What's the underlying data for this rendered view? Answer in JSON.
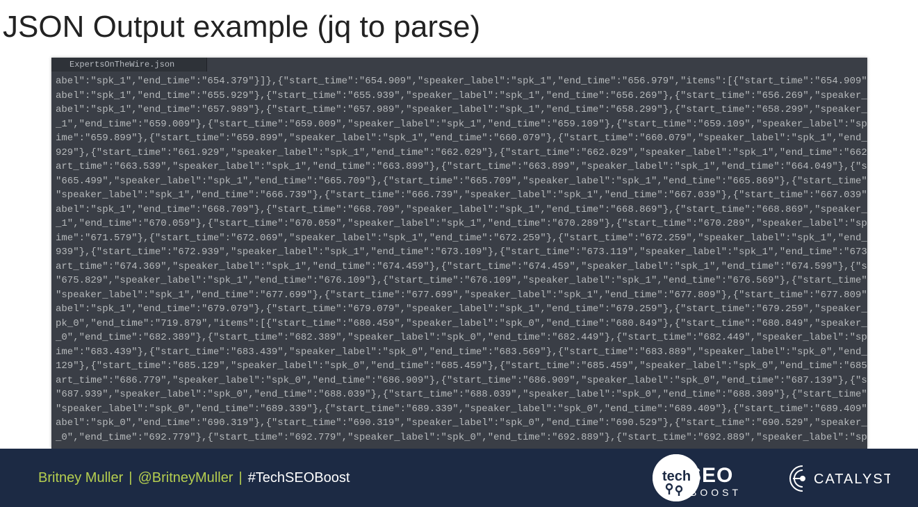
{
  "title": "JSON Output example (jq to parse)",
  "code": {
    "filename": "ExpertsOnTheWire.json",
    "lines": [
      "abel\":\"spk_1\",\"end_time\":\"654.379\"}]},{\"start_time\":\"654.909\",\"speaker_label\":\"spk_1\",\"end_time\":\"656.979\",\"items\":[{\"start_time\":\"654.909\",\"",
      "abel\":\"spk_1\",\"end_time\":\"655.929\"},{\"start_time\":\"655.939\",\"speaker_label\":\"spk_1\",\"end_time\":\"656.269\"},{\"start_time\":\"656.269\",\"speaker_l",
      "abel\":\"spk_1\",\"end_time\":\"657.989\"},{\"start_time\":\"657.989\",\"speaker_label\":\"spk_1\",\"end_time\":\"658.299\"},{\"start_time\":\"658.299\",\"speaker_l",
      "_1\",\"end_time\":\"659.009\"},{\"start_time\":\"659.009\",\"speaker_label\":\"spk_1\",\"end_time\":\"659.109\"},{\"start_time\":\"659.109\",\"speaker_label\":\"spk",
      "ime\":\"659.899\"},{\"start_time\":\"659.899\",\"speaker_label\":\"spk_1\",\"end_time\":\"660.079\"},{\"start_time\":\"660.079\",\"speaker_label\":\"spk_1\",\"end_t",
      "929\"},{\"start_time\":\"661.929\",\"speaker_label\":\"spk_1\",\"end_time\":\"662.029\"},{\"start_time\":\"662.029\",\"speaker_label\":\"spk_1\",\"end_time\":\"662.",
      "art_time\":\"663.539\",\"speaker_label\":\"spk_1\",\"end_time\":\"663.899\"},{\"start_time\":\"663.899\",\"speaker_label\":\"spk_1\",\"end_time\":\"664.049\"},{\"st",
      "\"665.499\",\"speaker_label\":\"spk_1\",\"end_time\":\"665.709\"},{\"start_time\":\"665.709\",\"speaker_label\":\"spk_1\",\"end_time\":\"665.869\"},{\"start_time\":",
      "\"speaker_label\":\"spk_1\",\"end_time\":\"666.739\"},{\"start_time\":\"666.739\",\"speaker_label\":\"spk_1\",\"end_time\":\"667.039\"},{\"start_time\":\"667.039\",",
      "abel\":\"spk_1\",\"end_time\":\"668.709\"},{\"start_time\":\"668.709\",\"speaker_label\":\"spk_1\",\"end_time\":\"668.869\"},{\"start_time\":\"668.869\",\"speaker_l",
      "_1\",\"end_time\":\"670.059\"},{\"start_time\":\"670.059\",\"speaker_label\":\"spk_1\",\"end_time\":\"670.289\"},{\"start_time\":\"670.289\",\"speaker_label\":\"spk",
      "ime\":\"671.579\"},{\"start_time\":\"672.069\",\"speaker_label\":\"spk_1\",\"end_time\":\"672.259\"},{\"start_time\":\"672.259\",\"speaker_label\":\"spk_1\",\"end_t",
      "939\"},{\"start_time\":\"672.939\",\"speaker_label\":\"spk_1\",\"end_time\":\"673.109\"},{\"start_time\":\"673.119\",\"speaker_label\":\"spk_1\",\"end_time\":\"673.",
      "art_time\":\"674.369\",\"speaker_label\":\"spk_1\",\"end_time\":\"674.459\"},{\"start_time\":\"674.459\",\"speaker_label\":\"spk_1\",\"end_time\":\"674.599\"},{\"st",
      "\"675.829\",\"speaker_label\":\"spk_1\",\"end_time\":\"676.109\"},{\"start_time\":\"676.109\",\"speaker_label\":\"spk_1\",\"end_time\":\"676.569\"},{\"start_time\":",
      "\"speaker_label\":\"spk_1\",\"end_time\":\"677.699\"},{\"start_time\":\"677.699\",\"speaker_label\":\"spk_1\",\"end_time\":\"677.809\"},{\"start_time\":\"677.809\",",
      "abel\":\"spk_1\",\"end_time\":\"679.079\"},{\"start_time\":\"679.079\",\"speaker_label\":\"spk_1\",\"end_time\":\"679.259\"},{\"start_time\":\"679.259\",\"speaker_l",
      "pk_0\",\"end_time\":\"719.879\",\"items\":[{\"start_time\":\"680.459\",\"speaker_label\":\"spk_0\",\"end_time\":\"680.849\"},{\"start_time\":\"680.849\",\"speaker_l",
      "_0\",\"end_time\":\"682.389\"},{\"start_time\":\"682.389\",\"speaker_label\":\"spk_0\",\"end_time\":\"682.449\"},{\"start_time\":\"682.449\",\"speaker_label\":\"spk",
      "ime\":\"683.439\"},{\"start_time\":\"683.439\",\"speaker_label\":\"spk_0\",\"end_time\":\"683.569\"},{\"start_time\":\"683.889\",\"speaker_label\":\"spk_0\",\"end_t",
      "129\"},{\"start_time\":\"685.129\",\"speaker_label\":\"spk_0\",\"end_time\":\"685.459\"},{\"start_time\":\"685.459\",\"speaker_label\":\"spk_0\",\"end_time\":\"685.",
      "art_time\":\"686.779\",\"speaker_label\":\"spk_0\",\"end_time\":\"686.909\"},{\"start_time\":\"686.909\",\"speaker_label\":\"spk_0\",\"end_time\":\"687.139\"},{\"st",
      "\"687.939\",\"speaker_label\":\"spk_0\",\"end_time\":\"688.039\"},{\"start_time\":\"688.039\",\"speaker_label\":\"spk_0\",\"end_time\":\"688.309\"},{\"start_time\":",
      "\"speaker_label\":\"spk_0\",\"end_time\":\"689.339\"},{\"start_time\":\"689.339\",\"speaker_label\":\"spk_0\",\"end_time\":\"689.409\"},{\"start_time\":\"689.409\",",
      "abel\":\"spk_0\",\"end_time\":\"690.319\"},{\"start_time\":\"690.319\",\"speaker_label\":\"spk_0\",\"end_time\":\"690.529\"},{\"start_time\":\"690.529\",\"speaker_l",
      "_0\",\"end_time\":\"692.779\"},{\"start_time\":\"692.779\",\"speaker_label\":\"spk_0\",\"end_time\":\"692.889\"},{\"start_time\":\"692.889\",\"speaker_label\":\"spk"
    ]
  },
  "footer": {
    "author": "Britney Muller",
    "handle": "@BritneyMuller",
    "hashtag": "#TechSEOBoost",
    "logo1": {
      "seo": "SEO",
      "boost": "BOOST"
    },
    "logo2": "CATALYST"
  }
}
